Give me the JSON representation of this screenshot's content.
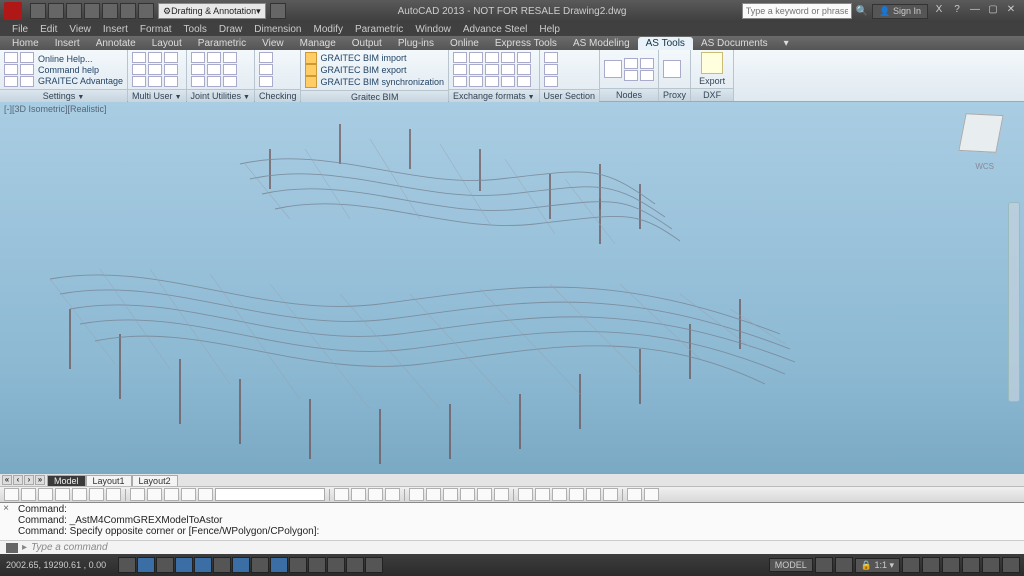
{
  "title": "AutoCAD 2013 - NOT FOR RESALE   Drawing2.dwg",
  "workspace": "Drafting & Annotation",
  "search_placeholder": "Type a keyword or phrase",
  "signin": "Sign In",
  "menus": [
    "File",
    "Edit",
    "View",
    "Insert",
    "Format",
    "Tools",
    "Draw",
    "Dimension",
    "Modify",
    "Parametric",
    "Window",
    "Advance Steel",
    "Help"
  ],
  "tabs": [
    "Home",
    "Insert",
    "Annotate",
    "Layout",
    "Parametric",
    "View",
    "Manage",
    "Output",
    "Plug-ins",
    "Online",
    "Express Tools",
    "AS Modeling",
    "AS Tools",
    "AS Documents"
  ],
  "active_tab": "AS Tools",
  "ribbon": {
    "settings": {
      "label": "Settings",
      "links": [
        "Online Help...",
        "Command help",
        "GRAITEC Advantage"
      ]
    },
    "multiuser": {
      "label": "Multi User"
    },
    "joint": {
      "label": "Joint Utilities"
    },
    "checking": {
      "label": "Checking"
    },
    "graitec_bim": {
      "label": "Graitec BIM",
      "links": [
        "GRAITEC BIM import",
        "GRAITEC BIM export",
        "GRAITEC BIM synchronization"
      ]
    },
    "exchange": {
      "label": "Exchange formats"
    },
    "usersection": {
      "label": "User Section"
    },
    "nodes": {
      "label": "Nodes"
    },
    "proxy": {
      "label": "Proxy"
    },
    "dxf": {
      "label": "DXF"
    },
    "export": {
      "label": "Export"
    }
  },
  "viewport_label": "[-][3D Isometric][Realistic]",
  "wcs": "WCS",
  "layout_tabs": [
    "Model",
    "Layout1",
    "Layout2"
  ],
  "active_layout": "Model",
  "command_lines": [
    "Command:",
    "Command:  _AstM4CommGREXModelToAstor",
    "Command: Specify opposite corner or [Fence/WPolygon/CPolygon]:"
  ],
  "cmd_input_placeholder": "Type a command",
  "status": {
    "coords": "2002.65, 19290.61 , 0.00",
    "model_chip": "MODEL",
    "scale": "1:1"
  }
}
